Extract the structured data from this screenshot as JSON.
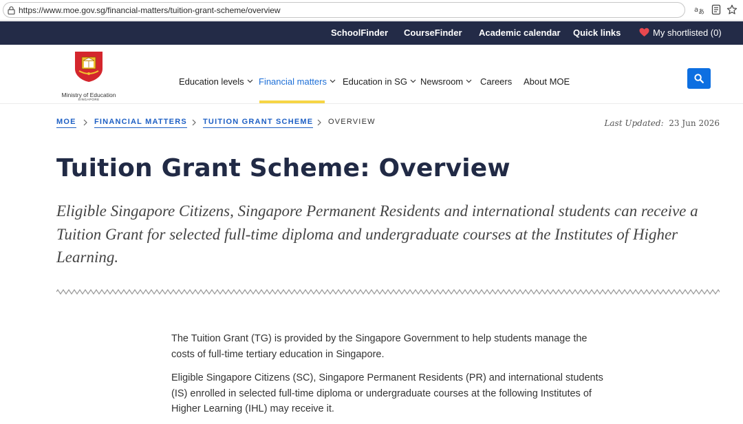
{
  "browser": {
    "url": "https://www.moe.gov.sg/financial-matters/tuition-grant-scheme/overview",
    "icons": [
      "lock-icon",
      "translate-icon",
      "reader-icon",
      "star-icon"
    ]
  },
  "utility_bar": {
    "links": [
      "SchoolFinder",
      "CourseFinder",
      "Academic calendar",
      "Quick links"
    ],
    "shortlist_label": "My shortlisted (0)",
    "heart_color": "#e8484f"
  },
  "logo": {
    "name": "Ministry of Education",
    "country": "SINGAPORE"
  },
  "nav": {
    "items": [
      {
        "label": "Education levels",
        "has_menu": true
      },
      {
        "label": "Financial matters",
        "has_menu": true,
        "active": true
      },
      {
        "label": "Education in SG",
        "has_menu": true
      },
      {
        "label": "Newsroom",
        "has_menu": true
      },
      {
        "label": "Careers",
        "has_menu": false
      },
      {
        "label": "About MOE",
        "has_menu": false
      }
    ],
    "accent": "#1d6fd7",
    "active_underline": "#f6d545"
  },
  "breadcrumb": {
    "items": [
      "MOE",
      "FINANCIAL MATTERS",
      "TUITION GRANT SCHEME"
    ],
    "current": "OVERVIEW"
  },
  "last_updated": {
    "label": "Last Updated:",
    "date": "23 Jun 2026"
  },
  "page": {
    "title": "Tuition Grant Scheme: Overview",
    "lead": "Eligible Singapore Citizens, Singapore Permanent Residents and international students can receive a Tuition Grant for selected full-time diploma and undergraduate courses at the Institutes of Higher Learning.",
    "paragraphs": [
      "The Tuition Grant (TG) is provided by the Singapore Government to help students manage the costs of full-time tertiary education in Singapore.",
      "Eligible Singapore Citizens (SC), Singapore Permanent Residents (PR) and international students (IS) enrolled in selected full-time diploma or undergraduate courses at the following Institutes of Higher Learning (IHL) may receive it."
    ]
  },
  "colors": {
    "utility_bar_bg": "#232b47",
    "search_button": "#0d6fe1",
    "title": "#212a45"
  }
}
